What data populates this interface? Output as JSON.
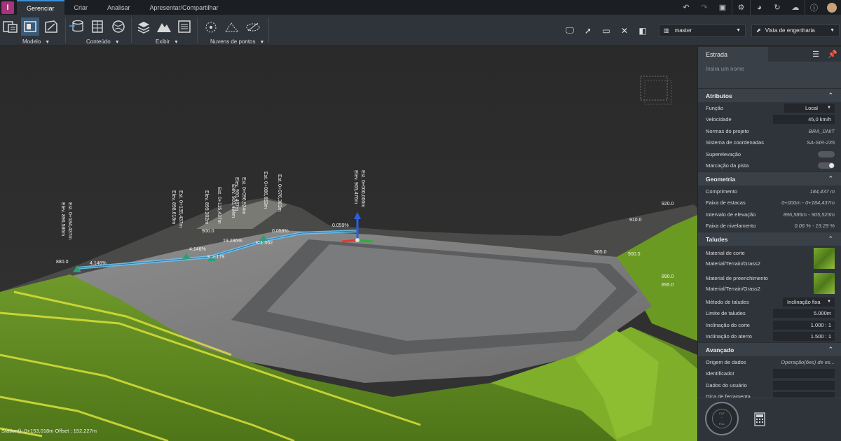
{
  "app": {
    "logo_letter": "I"
  },
  "tabs": [
    "Gerenciar",
    "Criar",
    "Analisar",
    "Apresentar/Compartilhar"
  ],
  "active_tab": 0,
  "top_icons": [
    "undo-icon",
    "redo-icon",
    "screen-icon",
    "gear-icon",
    "globe-icon",
    "refresh-icon",
    "cloud-icon",
    "help-icon",
    "avatar"
  ],
  "ribbon": {
    "groups": [
      {
        "label": "Modelo"
      },
      {
        "label": "Conteúdo"
      },
      {
        "label": "Exibir"
      },
      {
        "label": "Nuvens de pontos"
      }
    ],
    "version_dropdown": "master",
    "view_dropdown": "Vista de engenharia"
  },
  "viewport": {
    "status_text": "Station(): 0+153,018m Offset : 152,227m",
    "stations": [
      {
        "est": "Est. 0+184,437m",
        "elev": "Elev. 896,586m"
      },
      {
        "est": "Est. 0+135,437m",
        "elev": "Elev. 898,618m"
      },
      {
        "est": "Elev. 899,302m",
        "elev": ""
      },
      {
        "est": "Est. 0+115,437m",
        "elev": ""
      },
      {
        "est": "Elev. 900,484m",
        "elev": ""
      },
      {
        "est": "Est. 0+096,924m",
        "elev": "Elev. 900,467m"
      },
      {
        "est": "Est. 0+086,653m",
        "elev": ""
      },
      {
        "est": "Est. 0+076,381m",
        "elev": ""
      },
      {
        "est": "Est. 0+000,000m",
        "elev": "Elev. 905,476m"
      }
    ],
    "grades": [
      "4.146%",
      "4.146%",
      "19.286%",
      "0.059%",
      "0.059%"
    ],
    "vc_labels": [
      "K:2.179",
      "K:1.062"
    ],
    "contour_labels": [
      "880.0",
      "900.0",
      "920.0",
      "910.0",
      "905.0",
      "900.0",
      "890.0",
      "895.0"
    ]
  },
  "panel": {
    "tab_label": "Estrada",
    "name_placeholder": "Insira um nome",
    "atributos": {
      "title": "Atributos",
      "funcao_label": "Função",
      "funcao_value": "Local",
      "velocidade_label": "Velocidade",
      "velocidade_value": "45,0 km/h",
      "normas_label": "Normas do projeto",
      "normas_value": "BRA_DNIT",
      "sistema_label": "Sistema de coordenadas",
      "sistema_value": "SA-SIR-235",
      "superelevacao_label": "Superelevação",
      "marcacao_label": "Marcação da pista"
    },
    "geometria": {
      "title": "Geometria",
      "comprimento_label": "Comprimento",
      "comprimento_value": "184,437 m",
      "faixa_estacas_label": "Faixa de estacas",
      "faixa_estacas_value": "0+000m - 0+184,437m",
      "intervalo_label": "Intervalo de elevação",
      "intervalo_value": "896,586m - 905,523m",
      "nivelamento_label": "Faixa de nivelamento",
      "nivelamento_value": "0.06 % - 19.29 %"
    },
    "taludes": {
      "title": "Taludes",
      "corte_label": "Material de corte",
      "corte_value": "Material/Terrain/Grass2",
      "preenchimento_label": "Material de preenchimento",
      "preenchimento_value": "Material/Terrain/Grass2",
      "metodo_label": "Método de taludes",
      "metodo_value": "Inclinação fixa",
      "limite_label": "Limite de taludes",
      "limite_value": "5.000m",
      "incl_corte_label": "Inclinação do corte",
      "incl_corte_value": "1.000 : 1",
      "incl_aterro_label": "Inclinação do aterro",
      "incl_aterro_value": "1.500 : 1"
    },
    "avancado": {
      "title": "Avançado",
      "origem_label": "Origem de dados",
      "origem_value": "Operação(ões) de es...",
      "identificador_label": "Identificador",
      "dados_label": "Dados do usuário",
      "dica_label": "Dica de ferramenta"
    },
    "gauge": {
      "top": "CUT",
      "bottom": "FILL"
    }
  }
}
